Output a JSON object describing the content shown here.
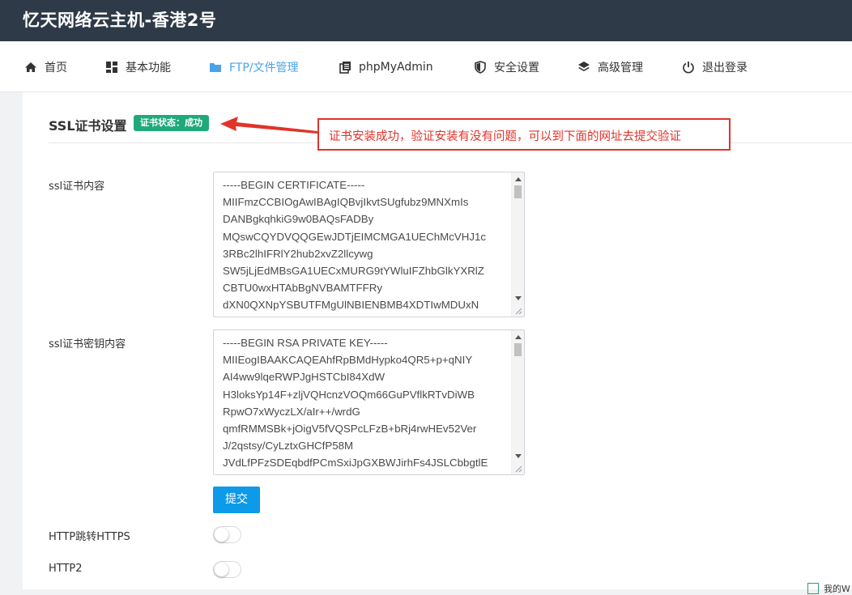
{
  "app": {
    "title": "忆天网络云主机-香港2号"
  },
  "nav": {
    "items": [
      {
        "label": "首页",
        "icon": "home-icon"
      },
      {
        "label": "基本功能",
        "icon": "grid-icon"
      },
      {
        "label": "FTP/文件管理",
        "icon": "folder-icon",
        "active": true
      },
      {
        "label": "phpMyAdmin",
        "icon": "database-icon"
      },
      {
        "label": "安全设置",
        "icon": "shield-icon"
      },
      {
        "label": "高级管理",
        "icon": "layers-icon"
      },
      {
        "label": "退出登录",
        "icon": "power-icon"
      }
    ]
  },
  "ssl": {
    "title": "SSL证书设置",
    "status_badge": "证书状态：成功",
    "cert_label": "ssl证书内容",
    "cert_value": "-----BEGIN CERTIFICATE-----\nMIIFmzCCBIOgAwIBAgIQBvjIkvtSUgfubz9MNXmIs\nDANBgkqhkiG9w0BAQsFADBy\nMQswCQYDVQQGEwJDTjEIMCMGA1UEChMcVHJ1c\n3RBc2lhIFRlY2hub2xvZ2llcywg\nSW5jLjEdMBsGA1UECxMURG9tYWluIFZhbGlkYXRlZ\nCBTU0wxHTAbBgNVBAMTFFRy\ndXN0QXNpYSBUTFMgUlNBIENBMB4XDTIwMDUxN\nDAwMDAwMFoXDTIxMDUxNDEyMDAwMFowGjEY",
    "key_label": "ssl证书密钥内容",
    "key_value": "-----BEGIN RSA PRIVATE KEY-----\nMIIEogIBAAKCAQEAhfRpBMdHypko4QR5+p+qNIY\nAI4ww9lqeRWPJgHSTCbI84XdW\nH3loksYp14F+zljVQHcnzVOQm66GuPVflkRTvDiWB\nRpwO7xWyczLX/aIr++/wrdG\nqmfRMMSBk+jOigV5fVQSPcLFzB+bRj4rwHEv52Ver\nJ/2qstsy/CyLztxGHCfP58M\nJVdLfPFzSDEqbdfPCmSxiJpGXBWJirhFs4JSLCbbgtlE",
    "submit_label": "提交",
    "http_redirect_label": "HTTP跳转HTTPS",
    "http2_label": "HTTP2"
  },
  "annotation": {
    "text": "证书安装成功，验证安装有没有问题，可以到下面的网址去提交验证"
  },
  "footer": {
    "corner_text": "我的W"
  },
  "colors": {
    "topbar": "#2f3a48",
    "accent": "#4aa3e8",
    "badge": "#1fa97b",
    "submit": "#0d9ae8",
    "callout": "#e0332a"
  }
}
